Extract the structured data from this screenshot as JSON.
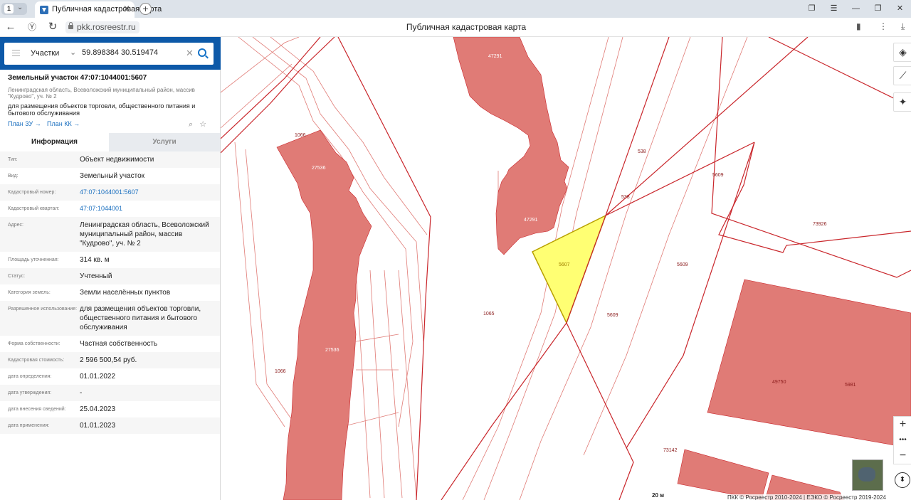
{
  "browser": {
    "tab_count": "1",
    "tab_title": "Публичная кадастровая карта",
    "url": "pkk.rosreestr.ru",
    "page_title": "Публичная кадастровая карта"
  },
  "search": {
    "type_label": "Участки",
    "query": "59.898384 30.519474"
  },
  "parcel": {
    "title": "Земельный участок 47:07:1044001:5607",
    "address": "Ленинградская область, Всеволожский муниципальный район, массив \"Кудрово\", уч. № 2",
    "use": "для размещения объектов торговли, общественного питания и бытового обслуживания",
    "plan_zu": "План ЗУ →",
    "plan_kk": "План КК →"
  },
  "tabs": {
    "info": "Информация",
    "services": "Услуги"
  },
  "rows": [
    {
      "k": "Тип:",
      "v": "Объект недвижимости"
    },
    {
      "k": "Вид:",
      "v": "Земельный участок"
    },
    {
      "k": "Кадастровый номер:",
      "v": "47:07:1044001:5607"
    },
    {
      "k": "Кадастровый квартал:",
      "v": "47:07:1044001"
    },
    {
      "k": "Адрес:",
      "v": "Ленинградская область, Всеволожский муниципальный район, массив \"Кудрово\", уч. № 2"
    },
    {
      "k": "Площадь уточненная:",
      "v": "314 кв. м"
    },
    {
      "k": "Статус:",
      "v": "Учтенный"
    },
    {
      "k": "Категория земель:",
      "v": "Земли населённых пунктов"
    },
    {
      "k": "Разрешенное использование:",
      "v": "для размещения объектов торговли, общественного питания и бытового обслуживания"
    },
    {
      "k": "Форма собственности:",
      "v": "Частная собственность"
    },
    {
      "k": "Кадастровая стоимость:",
      "v": "2 596 500,54 руб."
    },
    {
      "k": "дата определения:",
      "v": "01.01.2022"
    },
    {
      "k": "дата утверждения:",
      "v": "-"
    },
    {
      "k": "дата внесения сведений:",
      "v": "25.04.2023"
    },
    {
      "k": "дата применения:",
      "v": "01.01.2023"
    }
  ],
  "map": {
    "labels": {
      "l1066a": "1066",
      "l27536a": "27536",
      "l47291a": "47291",
      "l47291b": "47291",
      "l538a": "538",
      "l538b": "538",
      "l5609a": "5609",
      "l73926": "73926",
      "l5607": "5607",
      "l5609b": "5609",
      "l1065": "1065",
      "l5609c": "5609",
      "l27536b": "27536",
      "l1066b": "1066",
      "l49750": "49750",
      "l5981": "5981",
      "l73142": "73142"
    },
    "scale": "20 м",
    "copyright": "ПКК © Росреестр 2010-2024 | ЕЭКО © Росреестр 2019-2024",
    "colors": {
      "parcel_fill": "#e07b76",
      "selected_fill": "#ffff73",
      "line": "#c9262b"
    }
  }
}
